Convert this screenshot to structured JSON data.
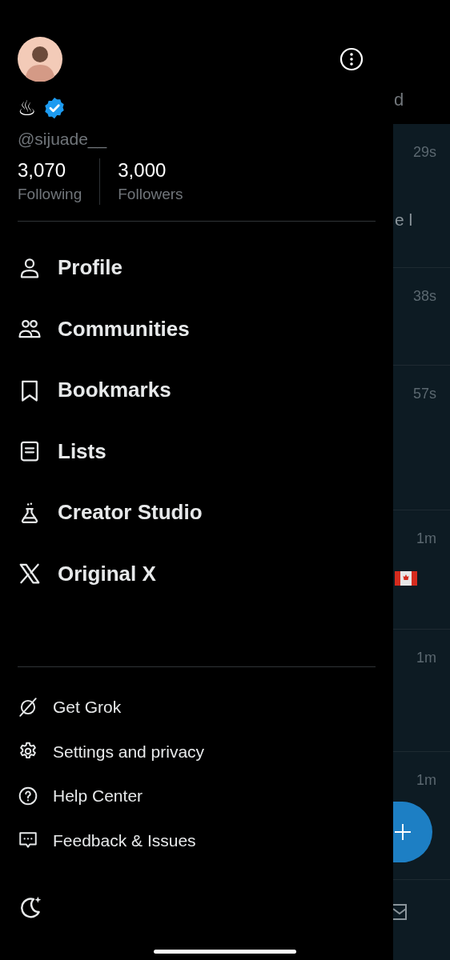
{
  "drawer": {
    "display_name": "♨",
    "verified": true,
    "handle": "@sijuade__",
    "stats": [
      {
        "count": "3,070",
        "label": "Following"
      },
      {
        "count": "3,000",
        "label": "Followers"
      }
    ],
    "menu": [
      {
        "label": "Profile"
      },
      {
        "label": "Communities"
      },
      {
        "label": "Bookmarks"
      },
      {
        "label": "Lists"
      },
      {
        "label": "Creator Studio"
      },
      {
        "label": "Original X"
      }
    ],
    "secondary_menu": [
      {
        "label": "Get Grok"
      },
      {
        "label": "Settings and privacy"
      },
      {
        "label": "Help Center"
      },
      {
        "label": "Feedback & Issues"
      }
    ]
  },
  "feed": {
    "header_fragment": "d",
    "items": [
      {
        "time": "29s",
        "text_fragment": "e l"
      },
      {
        "time": "38s"
      },
      {
        "time": "57s"
      },
      {
        "time": "1m",
        "flag": true
      },
      {
        "time": "1m"
      },
      {
        "time": "1m"
      }
    ]
  }
}
